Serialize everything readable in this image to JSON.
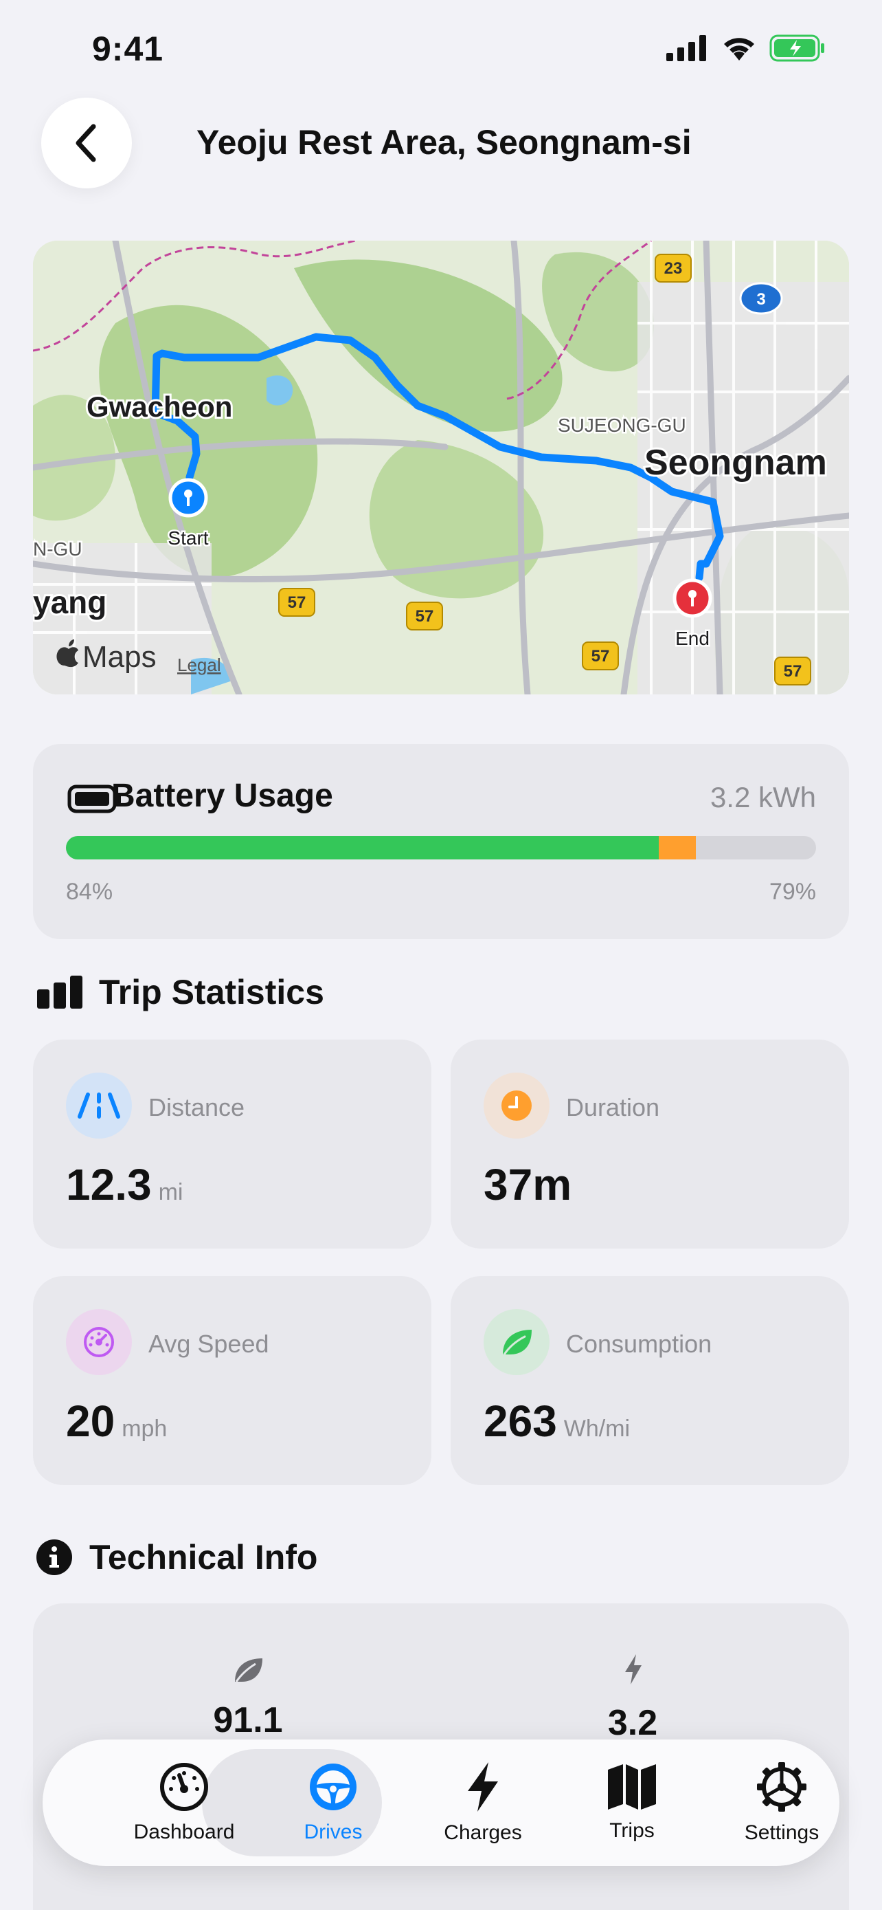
{
  "status_bar": {
    "time": "9:41"
  },
  "header": {
    "title": "Yeoju Rest Area, Seongnam-si"
  },
  "map": {
    "labels": {
      "gwacheon": "Gwacheon",
      "seongnam": "Seongnam",
      "sujeong": "SUJEONG-GU",
      "ngu": "N-GU",
      "yang": "yang",
      "start": "Start",
      "end": "End",
      "maps": "Maps",
      "legal": "Legal"
    },
    "road_badges": [
      "23",
      "3",
      "57",
      "57",
      "57",
      "57"
    ],
    "route_color": "#0a84ff"
  },
  "battery": {
    "title": "Battery Usage",
    "energy": "3.2 kWh",
    "start_label": "84%",
    "end_label": "79%",
    "start_fraction": 0.84,
    "end_fraction": 0.79,
    "used_color": "#ff9f2e",
    "remaining_color": "#34c759"
  },
  "trip_stats": {
    "title": "Trip Statistics",
    "items": [
      {
        "label": "Distance",
        "value": "12.3",
        "unit": "mi",
        "icon": "road-icon",
        "color": "#0a84ff"
      },
      {
        "label": "Duration",
        "value": "37m",
        "unit": "",
        "icon": "clock-icon",
        "color": "#ff9f2e"
      },
      {
        "label": "Avg Speed",
        "value": "20",
        "unit": "mph",
        "icon": "speedometer-icon",
        "color": "#bf5af2"
      },
      {
        "label": "Consumption",
        "value": "263",
        "unit": "Wh/mi",
        "icon": "leaf-icon",
        "color": "#34c759"
      }
    ]
  },
  "technical": {
    "title": "Technical Info",
    "items": [
      {
        "value": "91.1",
        "icon": "leaf-icon"
      },
      {
        "value": "3.2",
        "icon": "bolt-icon"
      }
    ]
  },
  "tabbar": {
    "tabs": [
      {
        "label": "Dashboard",
        "icon": "gauge-icon"
      },
      {
        "label": "Drives",
        "icon": "steering-wheel-icon"
      },
      {
        "label": "Charges",
        "icon": "bolt-icon"
      },
      {
        "label": "Trips",
        "icon": "map-icon"
      },
      {
        "label": "Settings",
        "icon": "gear-icon"
      }
    ],
    "active": "Drives"
  }
}
